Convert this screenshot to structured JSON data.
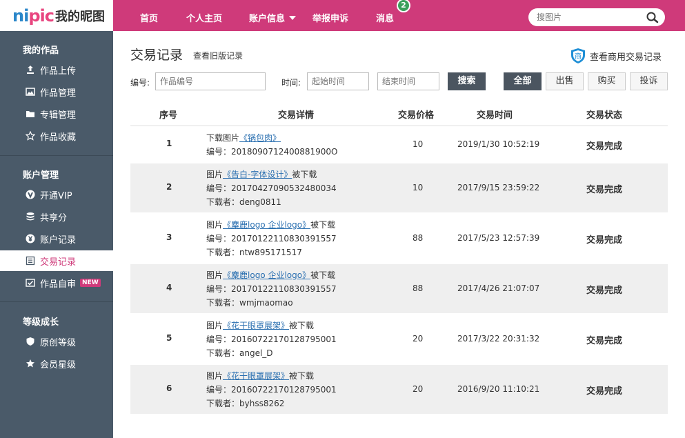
{
  "brand": {
    "logo_en_1": "ni",
    "logo_en_2": "pic",
    "logo_cn": "我的昵图"
  },
  "nav": {
    "items": [
      "首页",
      "个人主页",
      "账户信息",
      "举报申诉",
      "消息"
    ],
    "message_count": "2"
  },
  "search": {
    "placeholder": "搜图片"
  },
  "sidebar": {
    "sections": [
      {
        "title": "我的作品",
        "items": [
          "作品上传",
          "作品管理",
          "专辑管理",
          "作品收藏"
        ]
      },
      {
        "title": "账户管理",
        "items": [
          "开通VIP",
          "共享分",
          "账户记录",
          "交易记录",
          "作品自审"
        ]
      },
      {
        "title": "等级成长",
        "items": [
          "原创等级",
          "会员星级"
        ]
      }
    ],
    "new_tag": "NEW",
    "active_item": "交易记录"
  },
  "page": {
    "title": "交易记录",
    "old_link": "查看旧版记录",
    "biz_link": "查看商用交易记录",
    "biz_icon_text": "商"
  },
  "filters": {
    "id_label": "编号:",
    "id_placeholder": "作品编号",
    "time_label": "时间:",
    "start_placeholder": "起始时间",
    "end_placeholder": "结束时间",
    "search_button": "搜索",
    "tabs": [
      "全部",
      "出售",
      "购买",
      "投诉"
    ]
  },
  "table": {
    "headers": [
      "序号",
      "交易详情",
      "交易价格",
      "交易时间",
      "交易状态"
    ],
    "rows": [
      {
        "no": "1",
        "prefix": "下载图片",
        "link": "《锅包肉》",
        "suffix": "",
        "id": "编号：2018090712400881900O",
        "downloader": "",
        "price": "10",
        "time": "2019/1/30 10:52:19",
        "status": "交易完成"
      },
      {
        "no": "2",
        "prefix": "图片",
        "link": "《告白-字体设计》",
        "suffix": "被下载",
        "id": "编号：20170427090532480034",
        "downloader": "下载者：deng0811",
        "price": "10",
        "time": "2017/9/15 23:59:22",
        "status": "交易完成"
      },
      {
        "no": "3",
        "prefix": "图片",
        "link": "《麋鹿logo 企业logo》",
        "suffix": "被下载",
        "id": "编号：20170122110830391557",
        "downloader": "下载者：ntw895171517",
        "price": "88",
        "time": "2017/5/23 12:57:39",
        "status": "交易完成"
      },
      {
        "no": "4",
        "prefix": "图片",
        "link": "《麋鹿logo 企业logo》",
        "suffix": "被下载",
        "id": "编号：20170122110830391557",
        "downloader": "下载者：wmjmaomao",
        "price": "88",
        "time": "2017/4/26 21:07:07",
        "status": "交易完成"
      },
      {
        "no": "5",
        "prefix": "图片",
        "link": "《花干眼罩展架》",
        "suffix": "被下载",
        "id": "编号：20160722170128795001",
        "downloader": "下载者：angel_D",
        "price": "20",
        "time": "2017/3/22 20:31:32",
        "status": "交易完成"
      },
      {
        "no": "6",
        "prefix": "图片",
        "link": "《花干眼罩展架》",
        "suffix": "被下载",
        "id": "编号：20160722170128795001",
        "downloader": "下载者：byhss8262",
        "price": "20",
        "time": "2016/9/20 11:10:21",
        "status": "交易完成"
      }
    ]
  },
  "colors": {
    "brand_pink": "#cf3a7a",
    "sidebar": "#4a5a69",
    "link_blue": "#2a6fb0"
  }
}
